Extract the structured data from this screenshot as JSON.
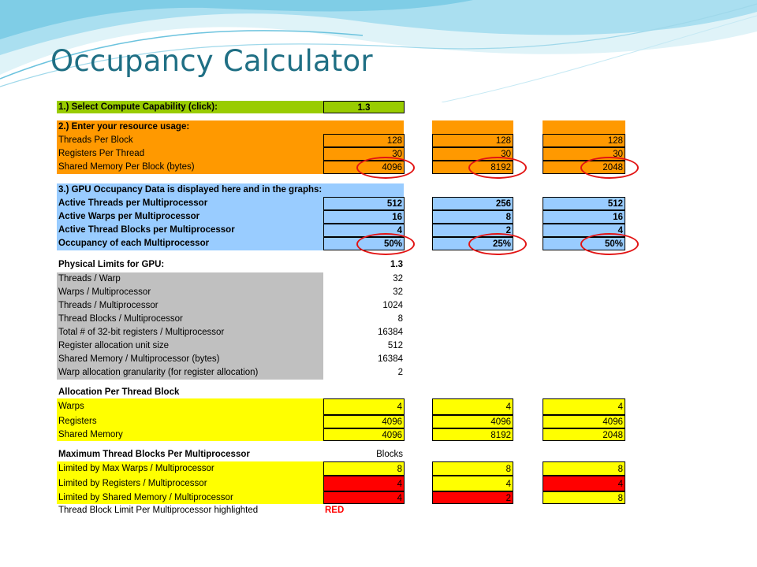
{
  "slide": {
    "title": "Occupancy Calculator"
  },
  "step1": {
    "label": "1.) Select Compute Capability (click):",
    "value": "1.3"
  },
  "step2": {
    "label": "2.) Enter your resource usage:",
    "rows": [
      {
        "label": "Threads Per Block",
        "values": [
          "128",
          "128",
          "128"
        ]
      },
      {
        "label": "Registers Per Thread",
        "values": [
          "30",
          "30",
          "30"
        ]
      },
      {
        "label": "Shared Memory Per Block (bytes)",
        "values": [
          "4096",
          "8192",
          "2048"
        ]
      }
    ]
  },
  "step3": {
    "label": "3.) GPU Occupancy Data is displayed here and in the graphs:",
    "rows": [
      {
        "label": "Active Threads per Multiprocessor",
        "values": [
          "512",
          "256",
          "512"
        ]
      },
      {
        "label": "Active Warps per Multiprocessor",
        "values": [
          "16",
          "8",
          "16"
        ]
      },
      {
        "label": "Active Thread Blocks per Multiprocessor",
        "values": [
          "4",
          "2",
          "4"
        ]
      },
      {
        "label": "Occupancy of each Multiprocessor",
        "values": [
          "50%",
          "25%",
          "50%"
        ]
      }
    ]
  },
  "physical": {
    "label": "Physical Limits for GPU:",
    "value": "1.3",
    "rows": [
      {
        "label": "Threads / Warp",
        "value": "32"
      },
      {
        "label": "Warps / Multiprocessor",
        "value": "32"
      },
      {
        "label": "Threads / Multiprocessor",
        "value": "1024"
      },
      {
        "label": "Thread Blocks / Multiprocessor",
        "value": "8"
      },
      {
        "label": "Total # of 32-bit registers / Multiprocessor",
        "value": "16384"
      },
      {
        "label": "Register allocation unit size",
        "value": "512"
      },
      {
        "label": "Shared Memory / Multiprocessor (bytes)",
        "value": "16384"
      },
      {
        "label": "Warp allocation granularity (for register allocation)",
        "value": "2"
      }
    ]
  },
  "allocation": {
    "label": "Allocation Per Thread Block",
    "rows": [
      {
        "label": "Warps",
        "values": [
          "4",
          "4",
          "4"
        ]
      },
      {
        "label": "Registers",
        "values": [
          "4096",
          "4096",
          "4096"
        ]
      },
      {
        "label": "Shared Memory",
        "values": [
          "4096",
          "8192",
          "2048"
        ]
      }
    ]
  },
  "maxblocks": {
    "label": "Maximum Thread Blocks Per Multiprocessor",
    "unit": "Blocks",
    "rows": [
      {
        "label": "Limited by Max Warps / Multiprocessor",
        "values": [
          "8",
          "8",
          "8"
        ],
        "highlight": [
          false,
          false,
          false
        ]
      },
      {
        "label": "Limited by Registers / Multiprocessor",
        "values": [
          "4",
          "4",
          "4"
        ],
        "highlight": [
          true,
          false,
          true
        ]
      },
      {
        "label": "Limited by Shared Memory / Multiprocessor",
        "values": [
          "4",
          "2",
          "8"
        ],
        "highlight": [
          true,
          true,
          false
        ]
      }
    ]
  },
  "footer": {
    "label": "Thread Block Limit Per Multiprocessor highlighted",
    "value": "RED"
  },
  "colors": {
    "title": "#1f6f84",
    "green": "#99cc00",
    "orange": "#ff9900",
    "blue": "#99ccff",
    "gray": "#c0c0c0",
    "yellow": "#ffff00",
    "red": "#ff0000",
    "circle": "#e21414"
  }
}
